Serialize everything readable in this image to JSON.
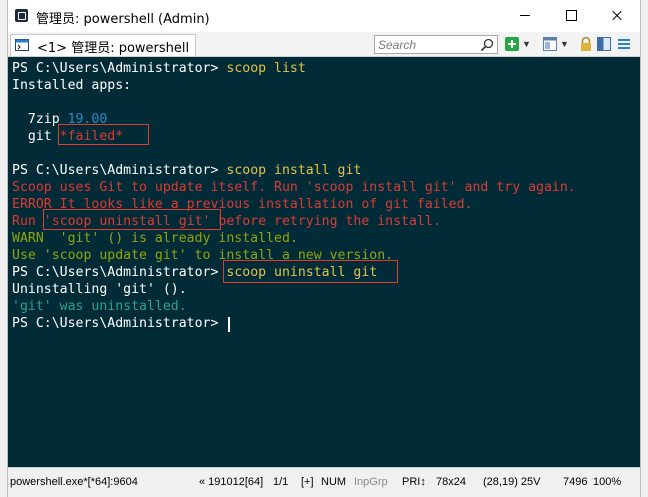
{
  "window": {
    "title": "管理员: powershell (Admin)"
  },
  "toolbar": {
    "tab_label": "<1> 管理员: powershell",
    "tab_icon": "console-tab-icon",
    "search_placeholder": "Search",
    "icons": [
      "search-icon",
      "new-console-icon",
      "view-icon",
      "lock-icon",
      "layout-icon",
      "menu-icon"
    ],
    "accent": "#2a7fd0"
  },
  "console": {
    "background": "#012b36",
    "lines": [
      {
        "parts": [
          {
            "text": "PS C:\\Users\\Administrator> ",
            "color": "white"
          },
          {
            "text": "scoop list",
            "color": "yellow"
          }
        ]
      },
      {
        "parts": [
          {
            "text": "Installed apps:",
            "color": "white"
          }
        ]
      },
      {
        "parts": [
          {
            "text": "",
            "color": "white"
          }
        ]
      },
      {
        "parts": [
          {
            "text": "  7zip ",
            "color": "white"
          },
          {
            "text": "19.00",
            "color": "teal"
          }
        ]
      },
      {
        "parts": [
          {
            "text": "  git ",
            "color": "white"
          },
          {
            "text": "*failed*",
            "color": "red"
          }
        ]
      },
      {
        "parts": [
          {
            "text": "",
            "color": "white"
          }
        ]
      },
      {
        "parts": [
          {
            "text": "PS C:\\Users\\Administrator> ",
            "color": "white"
          },
          {
            "text": "scoop install git",
            "color": "yellow"
          }
        ]
      },
      {
        "parts": [
          {
            "text": "Scoop uses Git to update itself. Run 'scoop install git' and try again.",
            "color": "red"
          }
        ]
      },
      {
        "parts": [
          {
            "text": "ERROR It looks like a previous installation of git failed.",
            "color": "red"
          }
        ]
      },
      {
        "parts": [
          {
            "text": "Run 'scoop uninstall git' before retrying the install.",
            "color": "red"
          }
        ]
      },
      {
        "parts": [
          {
            "text": "WARN  'git' () is already installed.",
            "color": "olive"
          }
        ]
      },
      {
        "parts": [
          {
            "text": "Use 'scoop update git' to install a new version.",
            "color": "olive"
          }
        ]
      },
      {
        "parts": [
          {
            "text": "PS C:\\Users\\Administrator> ",
            "color": "white"
          },
          {
            "text": "scoop uninstall git",
            "color": "yellow"
          }
        ]
      },
      {
        "parts": [
          {
            "text": "Uninstalling 'git' ().",
            "color": "white"
          }
        ]
      },
      {
        "parts": [
          {
            "text": "'git' was uninstalled.",
            "color": "darkteal"
          }
        ]
      },
      {
        "parts": [
          {
            "text": "PS C:\\Users\\Administrator> ",
            "color": "white"
          }
        ]
      }
    ],
    "colors": {
      "white": "#ffffff",
      "yellow": "#e3c24a",
      "red": "#dd3a34",
      "olive": "#93a40c",
      "teal": "#2b8bc6",
      "darkteal": "#2aa198"
    },
    "highlight_color": "#e03c31"
  },
  "statusbar": {
    "process": "powershell.exe*[*64]:9604",
    "build": "« 191012[64]",
    "pane": "1/1",
    "insert": "[+]",
    "num": "NUM",
    "inpgrp": "InpGrp",
    "pri": "PRI↕",
    "size": "78x24",
    "cursor_pos": "(28,19) 25V",
    "mem": "7496",
    "zoom": "100%"
  }
}
